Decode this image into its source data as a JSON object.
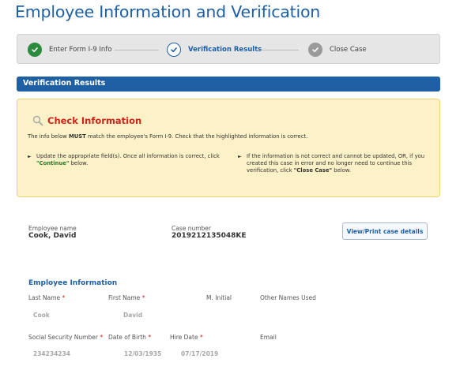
{
  "page": {
    "title": "Employee Information and Verification"
  },
  "stepper": {
    "steps": [
      {
        "label": "Enter Form I-9 Info",
        "state": "complete",
        "icon": "check-icon"
      },
      {
        "label": "Verification Results",
        "state": "current",
        "icon": "check-icon"
      },
      {
        "label": "Close Case",
        "state": "pending",
        "icon": "check-icon"
      }
    ]
  },
  "section": {
    "title": "Verification Results"
  },
  "alert": {
    "title": "Check Information",
    "icon": "search-icon",
    "desc_pre": "The info below ",
    "desc_strong": "MUST",
    "desc_post": " match the employee's Form I-9. Check that the highlighted information is correct.",
    "left_pre": "Update the appropriate field(s). Once all information is correct, click ",
    "left_strong": "\"Continue\"",
    "left_post": " below.",
    "right_pre": "If the information is not correct and cannot be updated, OR, if you created this case in error and no longer need to continue this verification, click ",
    "right_strong": "\"Close Case\"",
    "right_post": " below."
  },
  "case": {
    "employee_name_label": "Employee name",
    "employee_name": "Cook, David",
    "case_number_label": "Case number",
    "case_number": "2019212135048KE",
    "view_button": "View/Print case details"
  },
  "employee_info": {
    "title": "Employee Information",
    "last_name_label": "Last Name",
    "first_name_label": "First Name",
    "middle_initial_label": "M. Initial",
    "other_names_label": "Other Names Used",
    "last_name": "Cook",
    "first_name": "David",
    "ssn_label": "Social Security Number",
    "dob_label": "Date of Birth",
    "hire_date_label": "Hire Date",
    "email_label": "Email",
    "ssn": "234234234",
    "dob": "12/03/1935",
    "hire_date": "07/17/2019",
    "required_marker": "*"
  },
  "colors": {
    "brand_blue": "#1f5fa3",
    "success_green": "#2b8a3e",
    "alert_red": "#d0231b",
    "alert_bg": "#fdf1c7"
  }
}
